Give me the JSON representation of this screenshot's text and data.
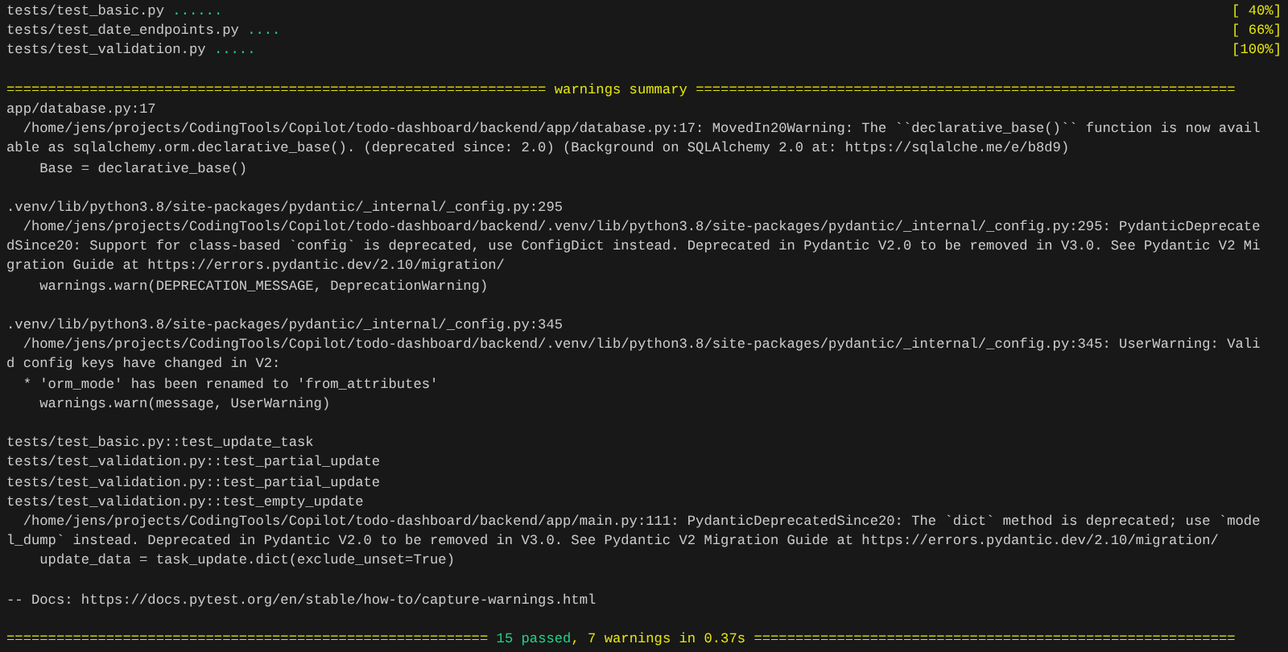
{
  "progress": [
    {
      "file": "tests/test_basic.py",
      "dots": "......",
      "percent": "[ 40%]"
    },
    {
      "file": "tests/test_date_endpoints.py",
      "dots": "....",
      "percent": "[ 66%]"
    },
    {
      "file": "tests/test_validation.py",
      "dots": ".....",
      "percent": "[100%]"
    }
  ],
  "warnings_header": {
    "rule_left": "=================================================================",
    "title": "warnings summary",
    "rule_right": "================================================================="
  },
  "blocks": [
    {
      "lines": [
        "app/database.py:17",
        "  /home/jens/projects/CodingTools/Copilot/todo-dashboard/backend/app/database.py:17: MovedIn20Warning: The ``declarative_base()`` function is now avail",
        "able as sqlalchemy.orm.declarative_base(). (deprecated since: 2.0) (Background on SQLAlchemy 2.0 at: https://sqlalche.me/e/b8d9)",
        "    Base = declarative_base()"
      ]
    },
    {
      "lines": [
        ".venv/lib/python3.8/site-packages/pydantic/_internal/_config.py:295",
        "  /home/jens/projects/CodingTools/Copilot/todo-dashboard/backend/.venv/lib/python3.8/site-packages/pydantic/_internal/_config.py:295: PydanticDeprecate",
        "dSince20: Support for class-based `config` is deprecated, use ConfigDict instead. Deprecated in Pydantic V2.0 to be removed in V3.0. See Pydantic V2 Mi",
        "gration Guide at https://errors.pydantic.dev/2.10/migration/",
        "    warnings.warn(DEPRECATION_MESSAGE, DeprecationWarning)"
      ]
    },
    {
      "lines": [
        ".venv/lib/python3.8/site-packages/pydantic/_internal/_config.py:345",
        "  /home/jens/projects/CodingTools/Copilot/todo-dashboard/backend/.venv/lib/python3.8/site-packages/pydantic/_internal/_config.py:345: UserWarning: Vali",
        "d config keys have changed in V2:",
        "  * 'orm_mode' has been renamed to 'from_attributes'",
        "    warnings.warn(message, UserWarning)"
      ]
    },
    {
      "lines": [
        "tests/test_basic.py::test_update_task",
        "tests/test_validation.py::test_partial_update",
        "tests/test_validation.py::test_partial_update",
        "tests/test_validation.py::test_empty_update",
        "  /home/jens/projects/CodingTools/Copilot/todo-dashboard/backend/app/main.py:111: PydanticDeprecatedSince20: The `dict` method is deprecated; use `mode",
        "l_dump` instead. Deprecated in Pydantic V2.0 to be removed in V3.0. See Pydantic V2 Migration Guide at https://errors.pydantic.dev/2.10/migration/",
        "    update_data = task_update.dict(exclude_unset=True)"
      ]
    },
    {
      "lines": [
        "-- Docs: https://docs.pytest.org/en/stable/how-to/capture-warnings.html"
      ]
    }
  ],
  "summary": {
    "rule_left": "==========================================================",
    "passed": "15 passed",
    "rest": ", 7 warnings in 0.37s",
    "rule_right": "=========================================================="
  }
}
